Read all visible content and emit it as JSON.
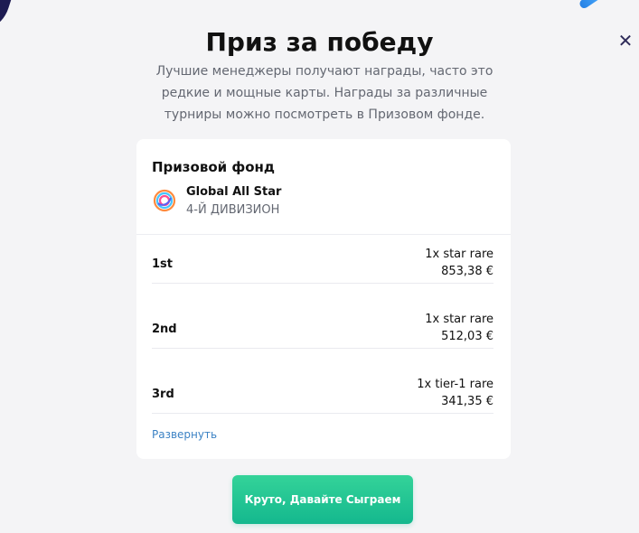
{
  "modal": {
    "title": "Приз за победу",
    "description": "Лучшие менеджеры получают награды, часто это редкие и мощные карты. Награды за различные турниры можно посмотреть в Призовом фонде.",
    "close_icon": "close-icon"
  },
  "prize_pool": {
    "title": "Призовой фонд",
    "tournament": {
      "name": "Global All Star",
      "division": "4-Й ДИВИЗИОН",
      "logo_icon": "tournament-logo-icon"
    },
    "rows": [
      {
        "place": "1st",
        "reward": "1x star rare",
        "amount": "853,38 €"
      },
      {
        "place": "2nd",
        "reward": "1x star rare",
        "amount": "512,03 €"
      },
      {
        "place": "3rd",
        "reward": "1x tier-1 rare",
        "amount": "341,35 €"
      }
    ],
    "expand_label": "Развернуть"
  },
  "cta": {
    "label": "Круто, Давайте Сыграем"
  },
  "colors": {
    "background": "#f4f4f6",
    "card": "#ffffff",
    "title": "#111111",
    "muted": "#646872",
    "link": "#3b82c4",
    "button_start": "#34d399",
    "button_end": "#14b88e",
    "close": "#2e2b59"
  }
}
